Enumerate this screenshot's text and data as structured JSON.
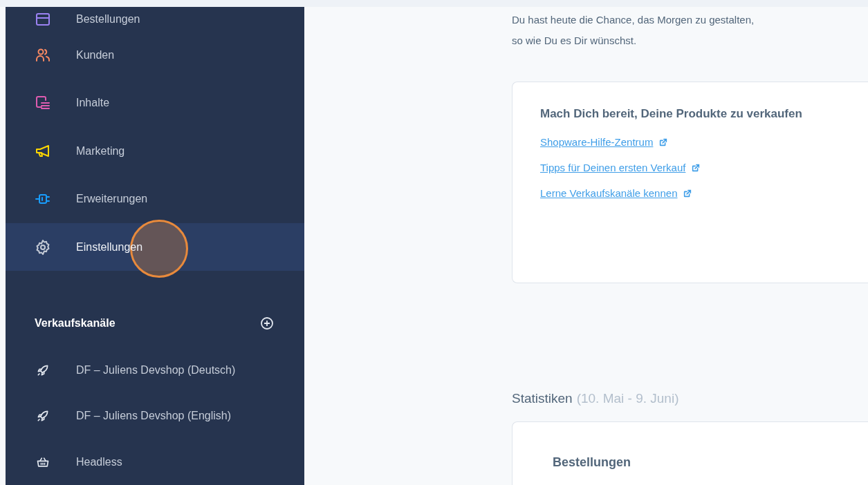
{
  "sidebar": {
    "items": [
      {
        "label": "Bestellungen",
        "kind": "orders",
        "color": "#9b82f3",
        "selected": false
      },
      {
        "label": "Kunden",
        "kind": "customers",
        "color": "#f88962",
        "selected": false
      },
      {
        "label": "Inhalte",
        "kind": "content",
        "color": "#de5cb0",
        "selected": false
      },
      {
        "label": "Marketing",
        "kind": "marketing",
        "color": "#ffd700",
        "selected": false
      },
      {
        "label": "Erweiterungen",
        "kind": "extensions",
        "color": "#189eff",
        "selected": false
      },
      {
        "label": "Einstellungen",
        "kind": "settings",
        "color": "#c5cbd6",
        "selected": true
      }
    ],
    "section": {
      "title": "Verkaufskanäle"
    },
    "channels": [
      {
        "label": "DF – Juliens Devshop (Deutsch)",
        "kind": "rocket"
      },
      {
        "label": "DF – Juliens Devshop (English)",
        "kind": "rocket"
      },
      {
        "label": "Headless",
        "kind": "basket"
      }
    ]
  },
  "main": {
    "intro": [
      "Du hast heute die Chance, das Morgen zu gestalten,",
      "so wie Du es Dir wünschst."
    ],
    "card": {
      "title": "Mach Dich bereit, Deine Produkte zu verkaufen",
      "links": [
        "Shopware-Hilfe-Zentrum",
        "Tipps für Deinen ersten Verkauf",
        "Lerne Verkaufskanäle kennen"
      ]
    },
    "statistics": {
      "title": "Statistiken",
      "range": "(10. Mai - 9. Juni)",
      "card_title": "Bestellungen"
    }
  }
}
